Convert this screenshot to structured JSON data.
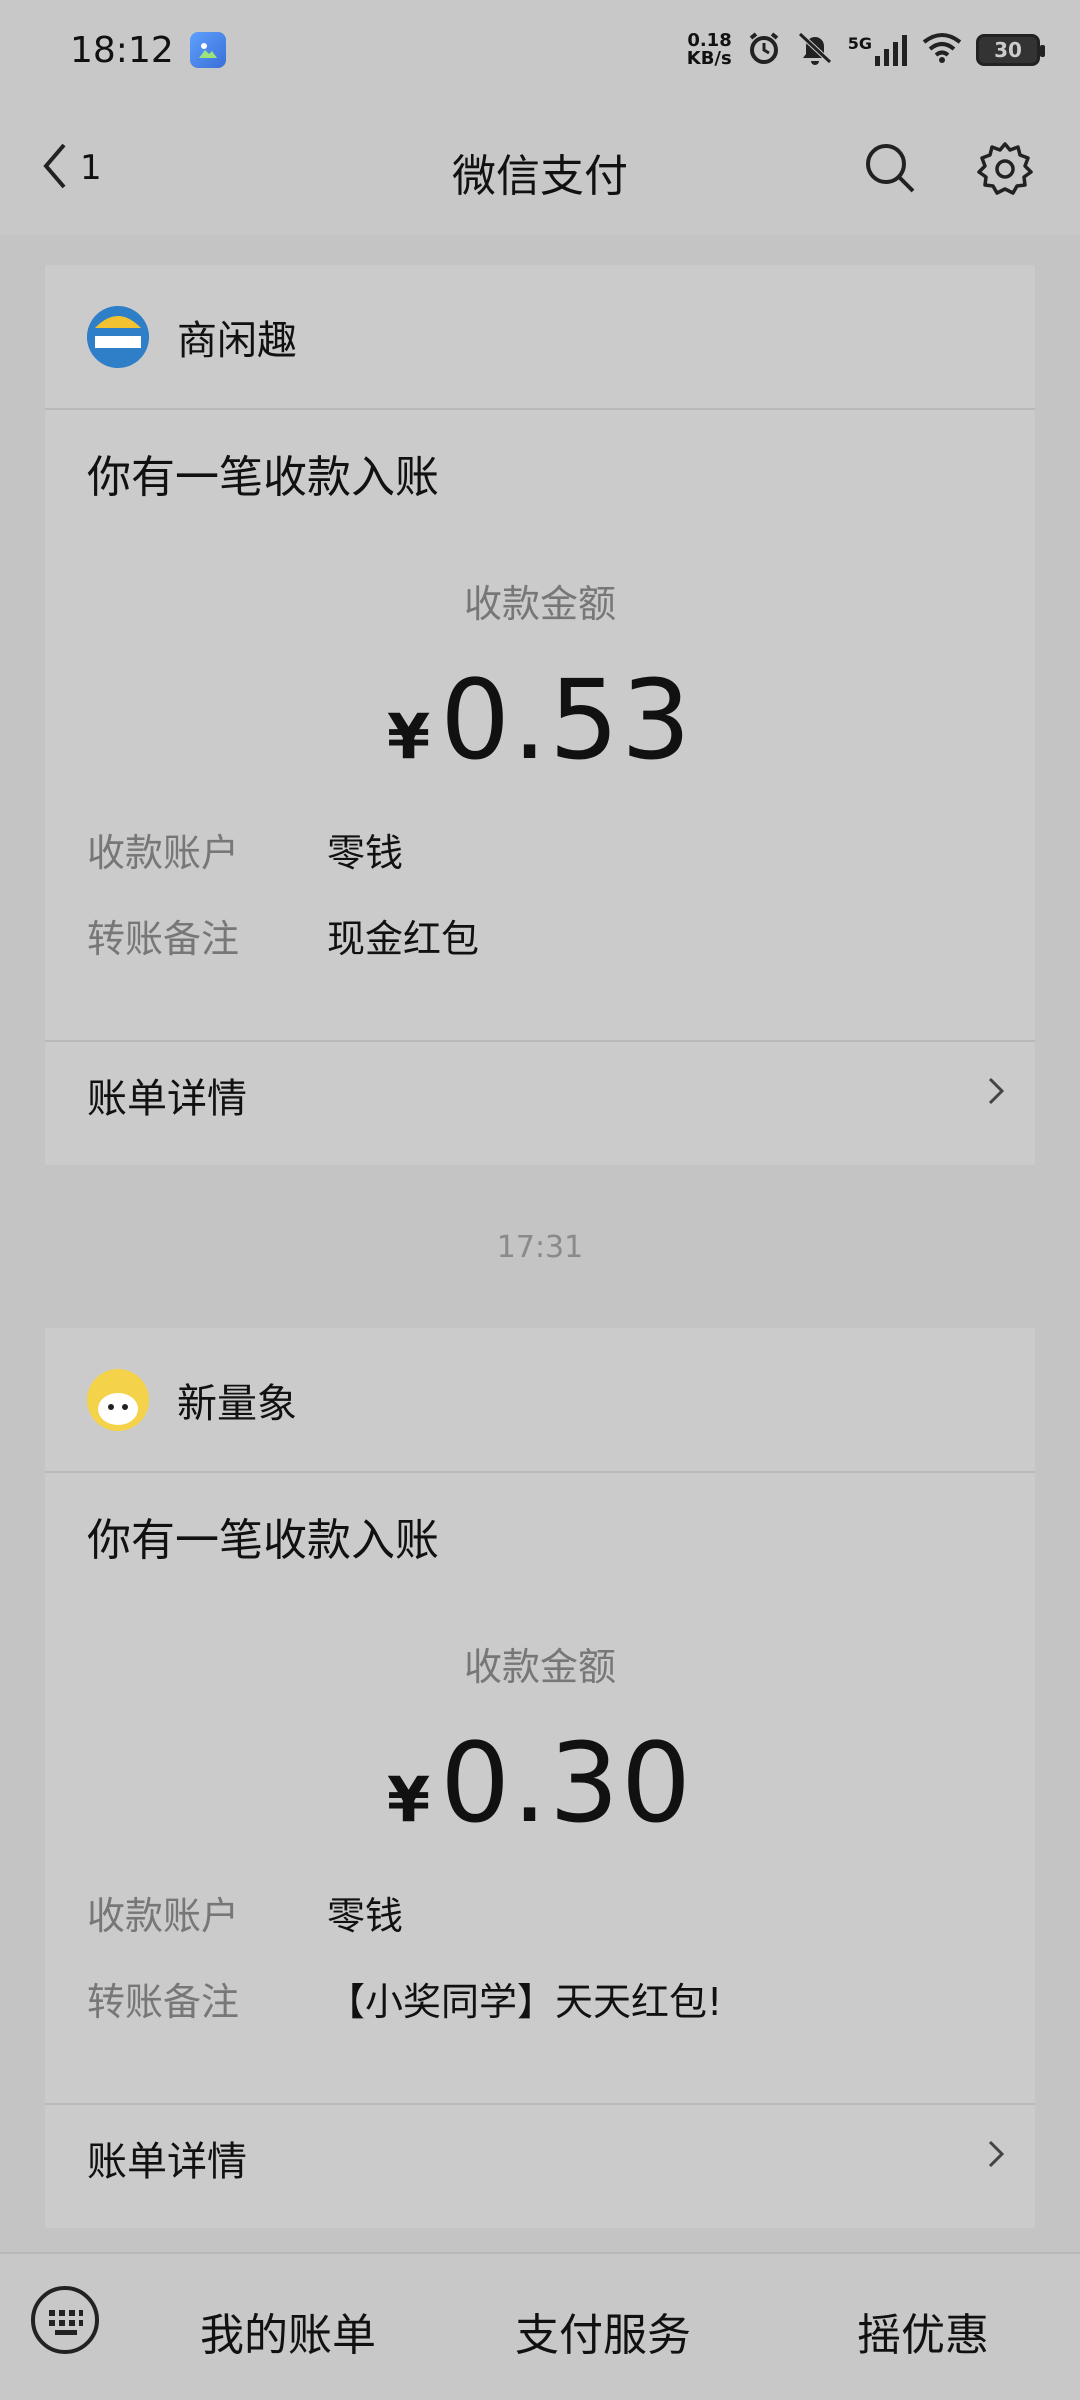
{
  "status_bar": {
    "time": "18:12",
    "net_speed_value": "0.18",
    "net_speed_unit": "KB/s",
    "network": "5G",
    "battery": "30"
  },
  "header": {
    "back_count": "1",
    "title": "微信支付"
  },
  "messages": [
    {
      "merchant": "商闲趣",
      "notice": "你有一笔收款入账",
      "amount_label": "收款金额",
      "currency": "¥",
      "amount": "0.53",
      "account_label": "收款账户",
      "account_value": "零钱",
      "remark_label": "转账备注",
      "remark_value": "现金红包",
      "detail_label": "账单详情"
    },
    {
      "merchant": "新量象",
      "notice": "你有一笔收款入账",
      "amount_label": "收款金额",
      "currency": "¥",
      "amount": "0.30",
      "account_label": "收款账户",
      "account_value": "零钱",
      "remark_label": "转账备注",
      "remark_value": "【小奖同学】天天红包!",
      "detail_label": "账单详情"
    }
  ],
  "timestamp": "17:31",
  "bottom_bar": {
    "tabs": [
      "我的账单",
      "支付服务",
      "摇优惠"
    ]
  },
  "colors": {
    "background": "#c4c4c4",
    "muted_text": "#777777",
    "primary_text": "#111111"
  }
}
